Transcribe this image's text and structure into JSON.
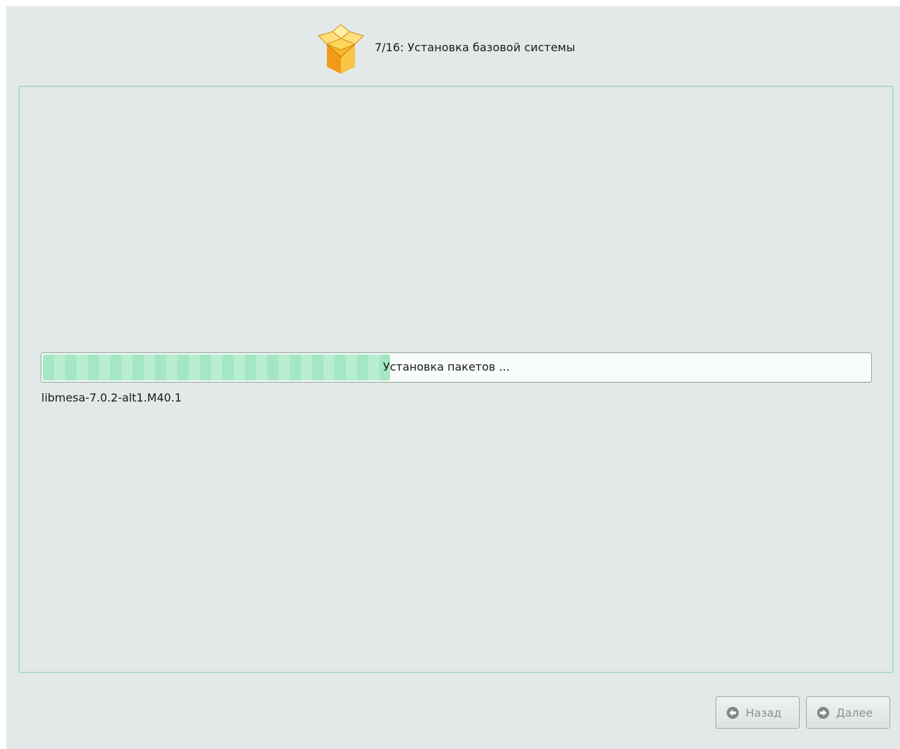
{
  "header": {
    "icon": "package-box-icon",
    "title": "7/16: Установка базовой системы"
  },
  "progress": {
    "label": "Установка пакетов ...",
    "fraction": 0.42
  },
  "package": {
    "current": "libmesa-7.0.2-alt1.M40.1"
  },
  "buttons": {
    "back_label": "Назад",
    "next_label": "Далее",
    "back_icon": "arrow-left-circle-icon",
    "next_icon": "arrow-right-circle-icon"
  },
  "colors": {
    "background": "#e2e9e8",
    "panel_border": "#b3dcc4",
    "progress_fill": "#a5e6c3"
  }
}
